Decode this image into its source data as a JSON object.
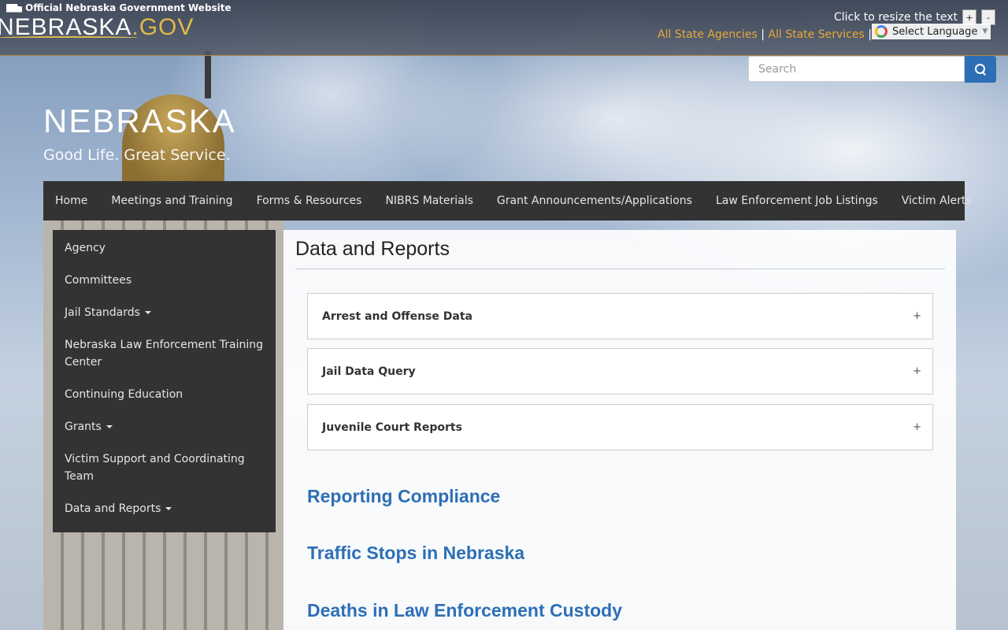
{
  "header": {
    "official_text": "Official Nebraska Government Website",
    "brand_main": "NEBRASKA",
    "brand_suffix": ".GOV",
    "resize_label": "Click to resize the text",
    "resize_plus": "+",
    "resize_minus": "-",
    "link_agencies": "All State Agencies",
    "link_separator": "|",
    "link_services": "All State Services",
    "translate_label": "Select Language",
    "translate_caret": "▼"
  },
  "search": {
    "placeholder": "Search"
  },
  "logo": {
    "title": "NEBRASKA",
    "tagline": "Good Life. Great Service."
  },
  "topnav": {
    "items": [
      "Home",
      "Meetings and Training",
      "Forms & Resources",
      "NIBRS Materials",
      "Grant Announcements/Applications",
      "Law Enforcement Job Listings",
      "Victim Alerts"
    ]
  },
  "sidenav": {
    "items": [
      "Agency",
      "Committees",
      "Jail Standards",
      "Nebraska Law Enforcement Training Center",
      "Continuing Education",
      "Grants",
      "Victim Support and Coordinating Team",
      "Data and Reports"
    ]
  },
  "main": {
    "title": "Data and Reports",
    "panels": [
      {
        "title": "Arrest and Offense Data",
        "toggle": "+"
      },
      {
        "title": "Jail Data Query",
        "toggle": "+"
      },
      {
        "title": "Juvenile Court Reports",
        "toggle": "+"
      }
    ],
    "sections": [
      "Reporting Compliance",
      "Traffic Stops in Nebraska",
      "Deaths in Law Enforcement Custody"
    ]
  },
  "colors": {
    "nav_bg": "#333333",
    "link_gold": "#e8a838",
    "accent_blue": "#2d6fb6"
  }
}
